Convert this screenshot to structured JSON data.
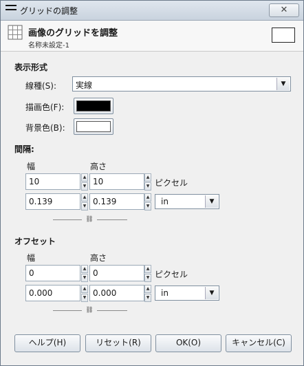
{
  "window": {
    "title": "グリッドの調整",
    "close_glyph": "✕"
  },
  "header": {
    "title": "画像のグリッドを調整",
    "subtitle": "名称未設定-1"
  },
  "display": {
    "section_label": "表示形式",
    "line_style_label": "線種(S):",
    "line_style_value": "実線",
    "fg_color_label": "描画色(F):",
    "fg_color": "#000000",
    "bg_color_label": "背景色(B):",
    "bg_color": "#ffffff"
  },
  "spacing": {
    "section_label": "間隔:",
    "width_label": "幅",
    "height_label": "高さ",
    "px_width": "10",
    "px_height": "10",
    "px_unit_label": "ピクセル",
    "in_width": "0.139",
    "in_height": "0.139",
    "unit_value": "in"
  },
  "offset": {
    "section_label": "オフセット",
    "width_label": "幅",
    "height_label": "高さ",
    "px_width": "0",
    "px_height": "0",
    "px_unit_label": "ピクセル",
    "in_width": "0.000",
    "in_height": "0.000",
    "unit_value": "in"
  },
  "buttons": {
    "help": "ヘルプ(H)",
    "reset": "リセット(R)",
    "ok": "OK(O)",
    "cancel": "キャンセル(C)"
  }
}
